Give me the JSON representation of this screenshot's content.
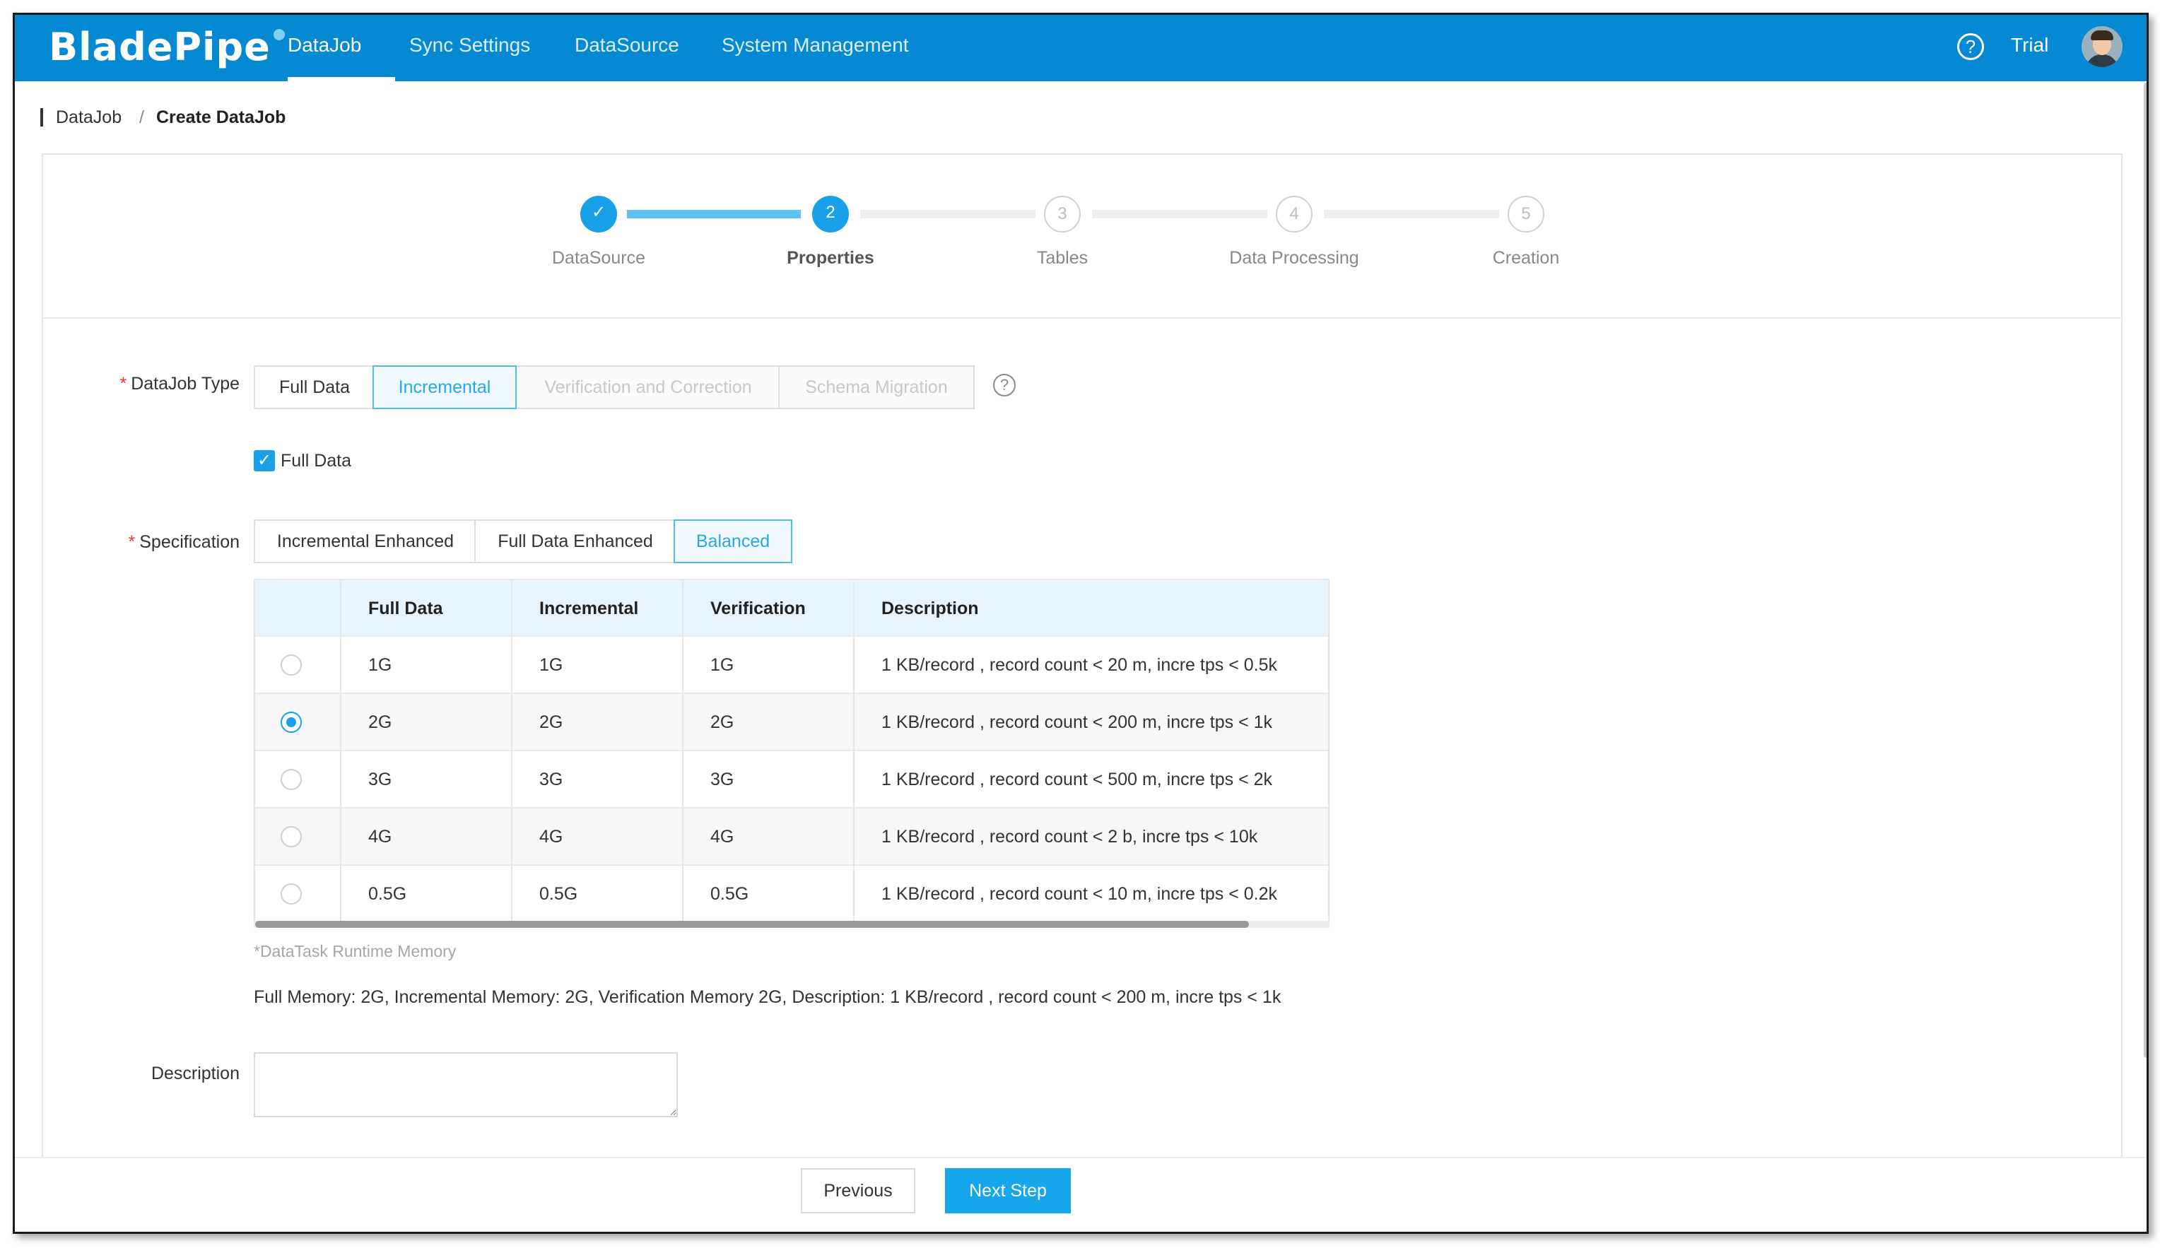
{
  "app": {
    "logo": "BladePipe",
    "nav": [
      "DataJob",
      "Sync Settings",
      "DataSource",
      "System Management"
    ],
    "active_nav": "DataJob",
    "help_icon": "question-circle-icon",
    "help_symbol": "?",
    "user_label": "Trial",
    "brand_color": "#0589d2",
    "accent_color": "#18a0e8"
  },
  "breadcrumb": {
    "parent": "DataJob",
    "separator": "/",
    "current": "Create DataJob"
  },
  "steps": {
    "items": [
      {
        "label": "DataSource",
        "marker": "✓",
        "state": "done"
      },
      {
        "label": "Properties",
        "marker": "2",
        "state": "current"
      },
      {
        "label": "Tables",
        "marker": "3",
        "state": "todo"
      },
      {
        "label": "Data Processing",
        "marker": "4",
        "state": "todo"
      },
      {
        "label": "Creation",
        "marker": "5",
        "state": "todo"
      }
    ]
  },
  "form": {
    "required_mark": "*",
    "datajob_type": {
      "label": "DataJob Type",
      "options": [
        "Full Data",
        "Incremental",
        "Verification and Correction",
        "Schema Migration"
      ],
      "selected": "Incremental",
      "disabled": [
        "Verification and Correction",
        "Schema Migration"
      ],
      "help_symbol": "?"
    },
    "full_data_checkbox": {
      "label": "Full Data",
      "checked": true,
      "check_symbol": "✓"
    },
    "specification": {
      "label": "Specification",
      "options": [
        "Incremental Enhanced",
        "Full Data Enhanced",
        "Balanced"
      ],
      "selected": "Balanced"
    },
    "spec_table": {
      "columns": [
        "",
        "Full Data",
        "Incremental",
        "Verification",
        "Description"
      ],
      "rows": [
        {
          "full": "1G",
          "incremental": "1G",
          "verification": "1G",
          "description": "1 KB/record , record count < 20 m, incre tps < 0.5k",
          "selected": false
        },
        {
          "full": "2G",
          "incremental": "2G",
          "verification": "2G",
          "description": "1 KB/record , record count < 200 m, incre tps < 1k",
          "selected": true
        },
        {
          "full": "3G",
          "incremental": "3G",
          "verification": "3G",
          "description": "1 KB/record , record count < 500 m, incre tps < 2k",
          "selected": false
        },
        {
          "full": "4G",
          "incremental": "4G",
          "verification": "4G",
          "description": "1 KB/record , record count < 2 b, incre tps < 10k",
          "selected": false
        },
        {
          "full": "0.5G",
          "incremental": "0.5G",
          "verification": "0.5G",
          "description": "1 KB/record , record count < 10 m, incre tps < 0.2k",
          "selected": false
        }
      ]
    },
    "runtime_note": "*DataTask Runtime Memory",
    "summary": "Full Memory: 2G, Incremental Memory: 2G, Verification Memory 2G, Description: 1 KB/record , record count < 200 m, incre tps < 1k",
    "description": {
      "label": "Description",
      "value": "",
      "placeholder": ""
    }
  },
  "footer": {
    "previous_label": "Previous",
    "next_label": "Next Step"
  }
}
